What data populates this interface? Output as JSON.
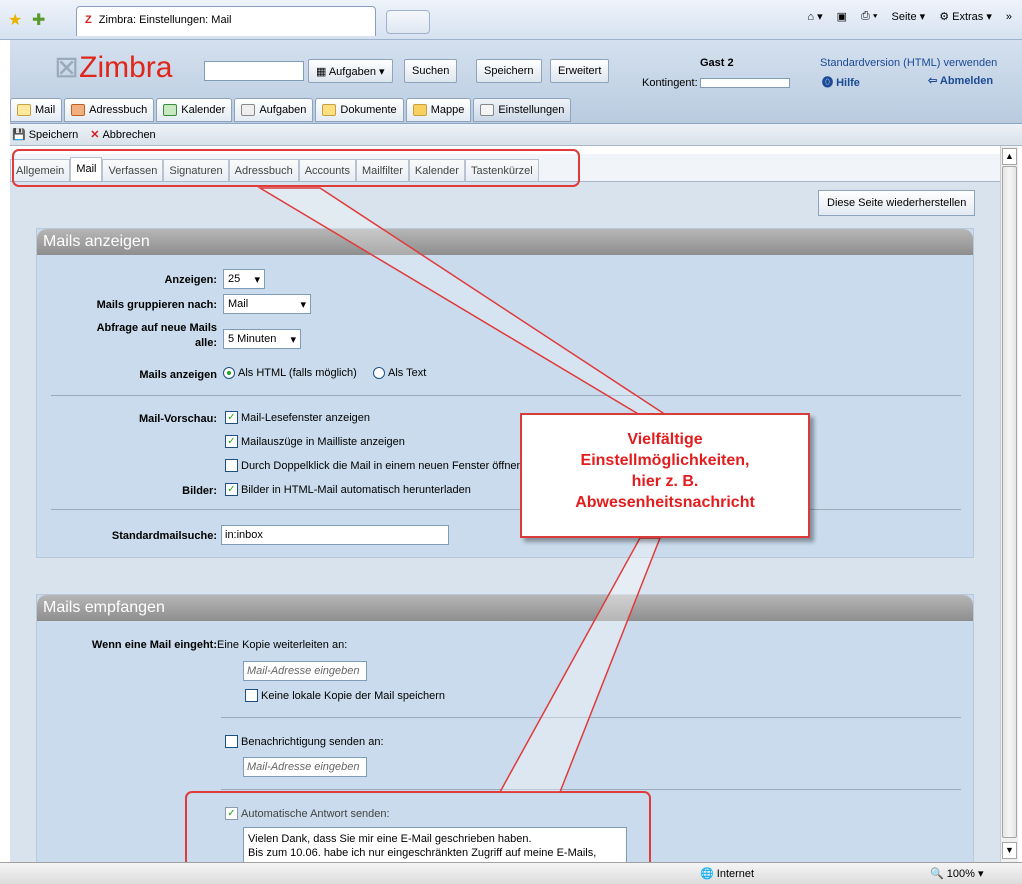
{
  "browser": {
    "tab_title": "Zimbra: Einstellungen: Mail",
    "seite_label": "Seite",
    "extras_label": "Extras",
    "status_zone": "Internet",
    "zoom": "100%"
  },
  "header": {
    "logo_text": "Zimbra",
    "search_value": "",
    "search_type": "Aufgaben",
    "search_btn": "Suchen",
    "save_btn": "Speichern",
    "advanced_btn": "Erweitert",
    "user_name": "Gast 2",
    "quota_label": "Kontingent:",
    "std_version_link": "Standardversion (HTML) verwenden",
    "help_link": "Hilfe",
    "logout_link": "Abmelden"
  },
  "app_tabs": [
    {
      "label": "Mail"
    },
    {
      "label": "Adressbuch"
    },
    {
      "label": "Kalender"
    },
    {
      "label": "Aufgaben"
    },
    {
      "label": "Dokumente"
    },
    {
      "label": "Mappe"
    },
    {
      "label": "Einstellungen"
    }
  ],
  "toolbar": {
    "save": "Speichern",
    "cancel": "Abbrechen"
  },
  "settings_tabs": [
    {
      "label": "Allgemein"
    },
    {
      "label": "Mail"
    },
    {
      "label": "Verfassen"
    },
    {
      "label": "Signaturen"
    },
    {
      "label": "Adressbuch"
    },
    {
      "label": "Accounts"
    },
    {
      "label": "Mailfilter"
    },
    {
      "label": "Kalender"
    },
    {
      "label": "Tastenkürzel"
    }
  ],
  "restore_btn": "Diese Seite wiederherstellen",
  "display": {
    "title": "Mails anzeigen",
    "show_label": "Anzeigen:",
    "show_value": "25",
    "group_label": "Mails gruppieren nach:",
    "group_value": "Mail",
    "poll_label_1": "Abfrage auf neue Mails",
    "poll_label_2": "alle:",
    "poll_value": "5 Minuten",
    "format_label": "Mails anzeigen",
    "format_html": "Als HTML (falls möglich)",
    "format_text": "Als Text",
    "preview_label": "Mail-Vorschau:",
    "preview_opt1": "Mail-Lesefenster anzeigen",
    "preview_opt2": "Mailauszüge in Mailliste anzeigen",
    "preview_opt3": "Durch Doppelklick die Mail in einem neuen Fenster öffnen",
    "images_label": "Bilder:",
    "images_opt": "Bilder in HTML-Mail automatisch herunterladen",
    "search_label": "Standardmailsuche:",
    "search_value": "in:inbox"
  },
  "receive": {
    "title": "Mails empfangen",
    "when_label": "Wenn eine Mail eingeht:",
    "forward_text": "Eine Kopie weiterleiten an:",
    "forward_placeholder": "Mail-Adresse eingeben",
    "no_local_copy": "Keine lokale Kopie der Mail speichern",
    "notify_text": "Benachrichtigung senden an:",
    "notify_placeholder": "Mail-Adresse eingeben",
    "auto_reply": "Automatische Antwort senden:",
    "auto_reply_line1": "Vielen Dank, dass Sie mir eine E-Mail geschrieben haben.",
    "auto_reply_line2": "Bis zum 10.06. habe ich nur eingeschränkten Zugriff auf meine E-Mails,"
  },
  "callout": {
    "line1": "Vielfältige",
    "line2": "Einstellmöglichkeiten,",
    "line3": "hier z. B.",
    "line4": "Abwesenheitsnachricht"
  },
  "colors": {
    "accent_red": "#e31d1d",
    "header_blue": "#b9cbe0",
    "section_blue": "#c9dbec"
  }
}
